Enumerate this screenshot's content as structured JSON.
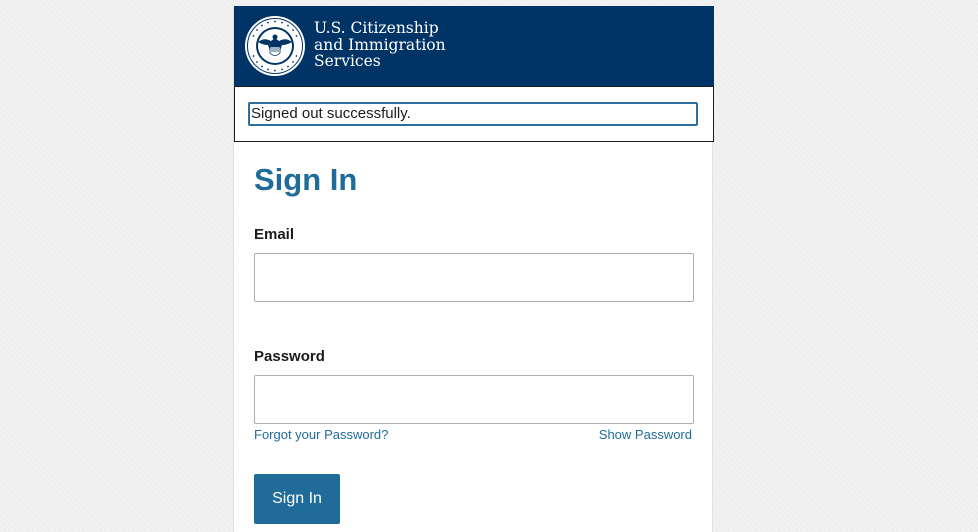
{
  "header": {
    "seal_icon": "dhs-seal-icon",
    "org_line1": "U.S. Citizenship",
    "org_line2": "and Immigration",
    "org_line3": "Services"
  },
  "alert": {
    "message": "Signed out successfully."
  },
  "signin": {
    "title": "Sign In",
    "email_label": "Email",
    "email_value": "",
    "password_label": "Password",
    "password_value": "",
    "forgot_link": "Forgot your Password?",
    "show_password_link": "Show Password",
    "submit_label": "Sign In"
  },
  "colors": {
    "header_bg": "#003366",
    "accent": "#1f6b99",
    "focus_border": "#2e6e9e",
    "input_border": "#a9aeb1"
  }
}
